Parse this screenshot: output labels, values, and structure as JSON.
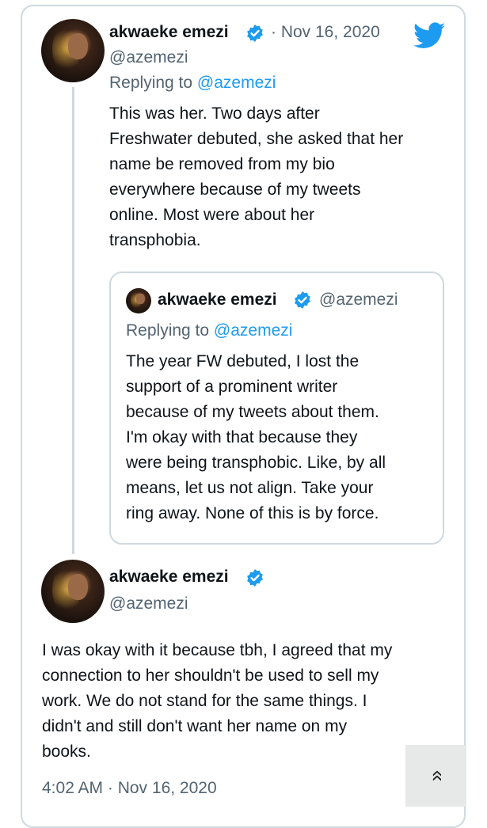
{
  "main_tweet": {
    "display_name": "akwaeke emezi",
    "handle": "@azemezi",
    "date": "· Nov 16, 2020",
    "replying_prefix": "Replying to ",
    "replying_handle": "@azemezi",
    "lines": [
      "This was her. Two days after",
      "Freshwater debuted, she asked that her",
      "name be removed from my bio",
      "everywhere because of my tweets",
      "online. Most were about her",
      "transphobia."
    ]
  },
  "quoted_tweet": {
    "display_name": "akwaeke emezi",
    "handle": "@azemezi",
    "replying_prefix": "Replying to ",
    "replying_handle": "@azemezi",
    "lines": [
      "The year FW debuted, I lost the",
      "support of a prominent writer",
      "because of my tweets about them.",
      "I'm okay with that because they",
      "were being transphobic. Like, by all",
      "means, let us not align. Take your",
      "ring away. None of this is by force."
    ]
  },
  "focused_tweet": {
    "display_name": "akwaeke emezi",
    "handle": "@azemezi",
    "lines": [
      "I was okay with it because tbh, I agreed that my",
      "connection to her shouldn't be used to sell my",
      "work. We do not stand for the same things. I",
      "didn't and still don't want her name on my",
      "books."
    ],
    "timestamp": "4:02 AM · Nov 16, 2020"
  },
  "icons": {
    "brand": "twitter-bird-icon",
    "verified": "verified-badge-icon",
    "scroll": "double-chevron-up-icon"
  },
  "colors": {
    "accent": "#1d9bf0",
    "text": "#0f1419",
    "secondary": "#536471",
    "border": "#cfd9de"
  },
  "scroll_top_label": "»"
}
